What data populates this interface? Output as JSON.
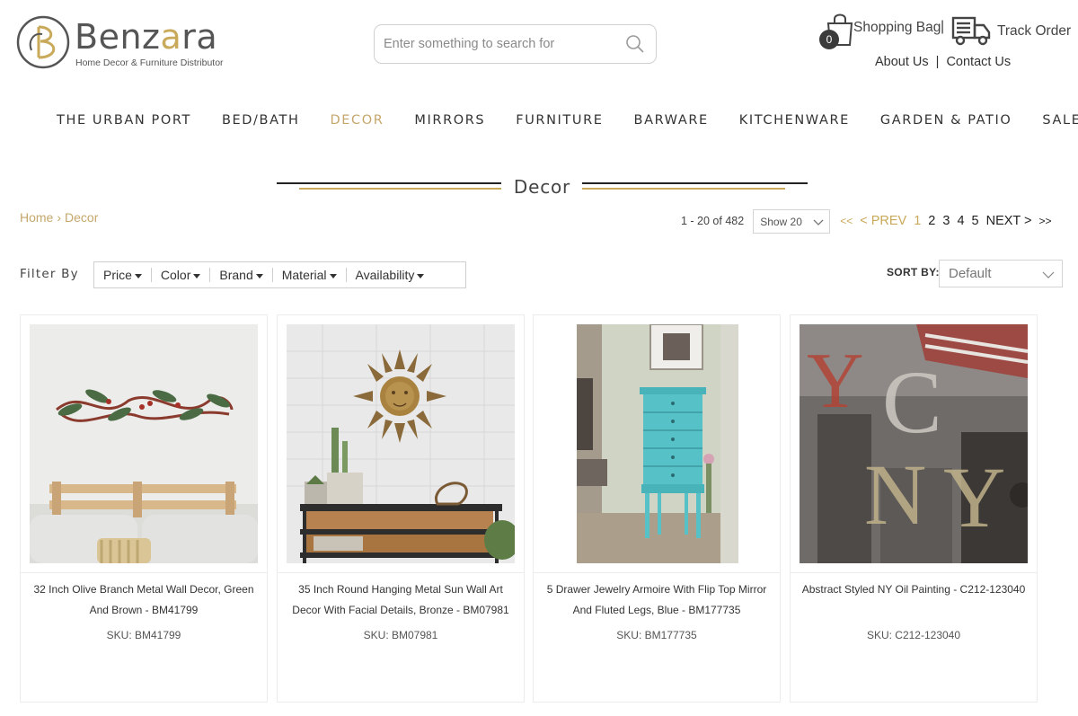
{
  "brand": {
    "name_first": "Benz",
    "name_gold": "a",
    "name_rest": "ra",
    "tagline": "Home Decor & Furniture Distributor"
  },
  "search": {
    "placeholder": "Enter something to search for"
  },
  "header": {
    "bag_count": "0",
    "bag_label": "Shopping Bag",
    "divider": "|",
    "track_label": "Track Order",
    "about": "About Us",
    "contact": "Contact Us"
  },
  "nav": {
    "items": [
      {
        "label": "THE URBAN PORT"
      },
      {
        "label": "BED/BATH"
      },
      {
        "label": "DECOR"
      },
      {
        "label": "MIRRORS"
      },
      {
        "label": "FURNITURE"
      },
      {
        "label": "BARWARE"
      },
      {
        "label": "KITCHENWARE"
      },
      {
        "label": "GARDEN & PATIO"
      },
      {
        "label": "SALE"
      }
    ],
    "active": "DECOR"
  },
  "page": {
    "title": "Decor"
  },
  "breadcrumb": {
    "home": "Home",
    "separator": "›",
    "current": "Decor"
  },
  "pagination": {
    "range": "1 - 20 of 482",
    "show": "Show 20",
    "first": "<<",
    "prev": "< PREV",
    "pages": [
      "1",
      "2",
      "3",
      "4",
      "5"
    ],
    "current_page": "1",
    "next": "NEXT >",
    "last": ">>"
  },
  "filters": {
    "label": "Filter By",
    "items": [
      {
        "label": "Price"
      },
      {
        "label": "Color"
      },
      {
        "label": "Brand"
      },
      {
        "label": "Material"
      },
      {
        "label": "Availability"
      }
    ]
  },
  "sort": {
    "label": "SORT BY:",
    "value": "Default"
  },
  "products": [
    {
      "name": "32 Inch Olive Branch Metal Wall Decor, Green And Brown - BM41799",
      "sku": "SKU: BM41799"
    },
    {
      "name": "35 Inch Round Hanging Metal Sun Wall Art Decor With Facial Details, Bronze - BM07981",
      "sku": "SKU: BM07981"
    },
    {
      "name": "5 Drawer Jewelry Armoire With Flip Top Mirror And Fluted Legs, Blue - BM177735",
      "sku": "SKU: BM177735"
    },
    {
      "name": "Abstract Styled NY Oil Painting - C212-123040",
      "sku": "SKU: C212-123040"
    }
  ],
  "colors": {
    "gold": "#c9a95a",
    "text": "#333333",
    "border": "#d0d0d0"
  }
}
